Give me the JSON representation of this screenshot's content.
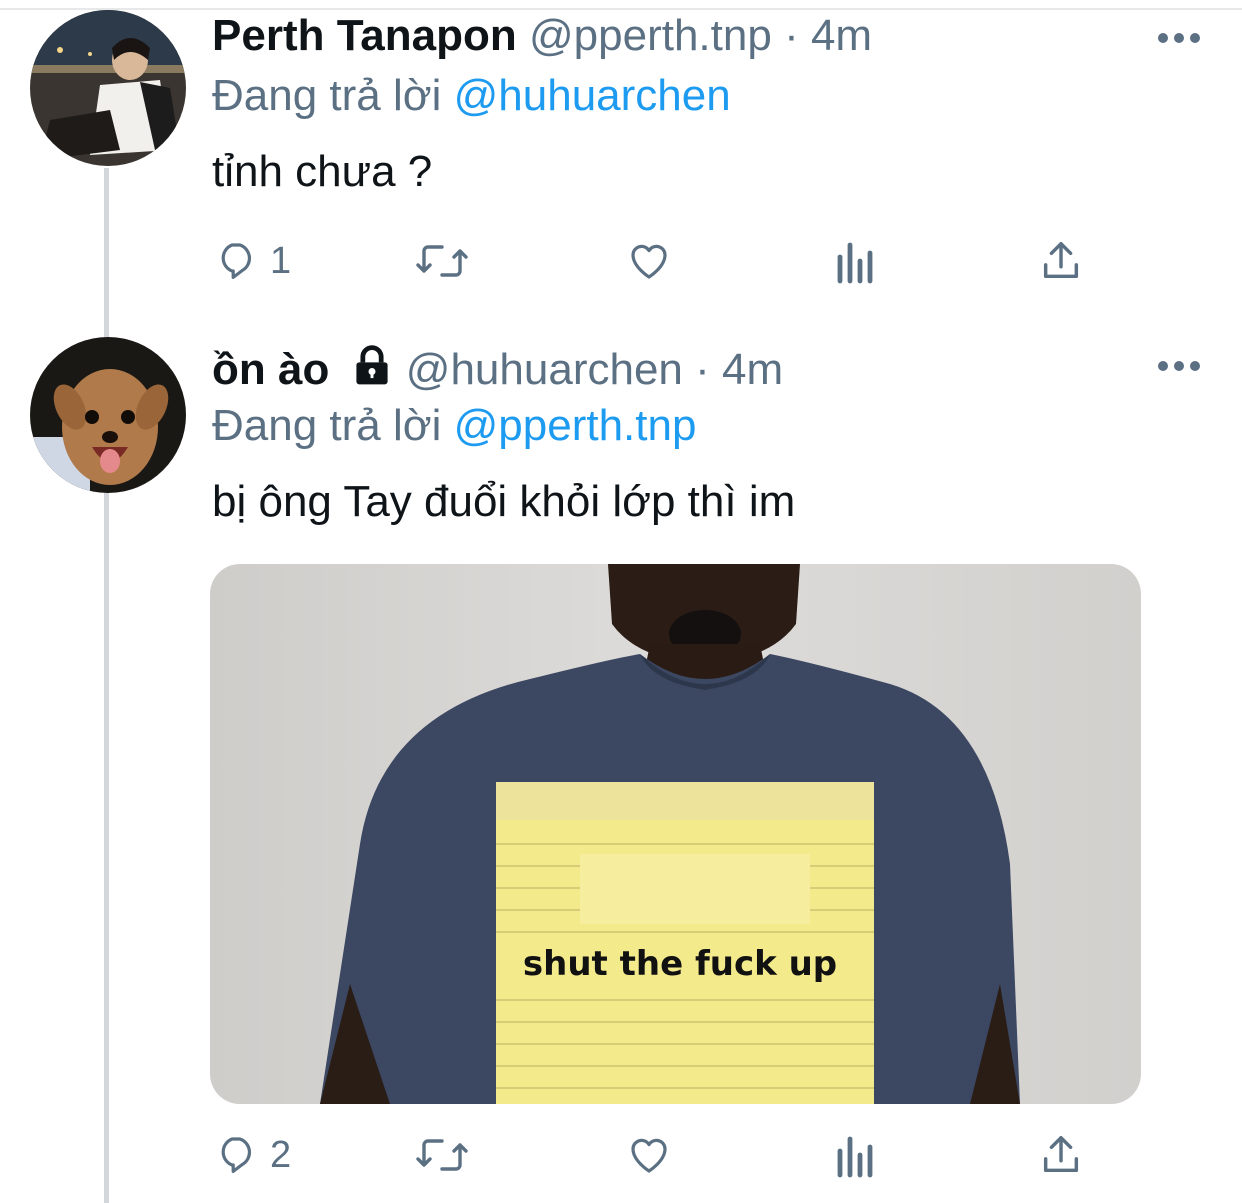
{
  "tweets": [
    {
      "name": "Perth Tanapon",
      "handle": "@pperth.tnp",
      "time": "4m",
      "replying_prefix": "Đang trả lời",
      "replying_to": "@huhuarchen",
      "text": "tỉnh chưa ?",
      "reply_count": "1",
      "locked": false
    },
    {
      "name": "ồn ào",
      "handle": "@huhuarchen",
      "time": "4m",
      "replying_prefix": "Đang trả lời",
      "replying_to": "@pperth.tnp",
      "text": "bị ông Tay đuổi khỏi lớp thì im",
      "reply_count": "2",
      "locked": true,
      "media_caption": "shut the fuck up"
    }
  ],
  "separator": "·",
  "icons": [
    "reply-icon",
    "retweet-icon",
    "like-icon",
    "analytics-icon",
    "share-icon",
    "more-icon",
    "lock-icon"
  ],
  "colors": {
    "link": "#1d9bf0",
    "secondary": "#5b7083",
    "thread_line": "#d3d7db"
  }
}
